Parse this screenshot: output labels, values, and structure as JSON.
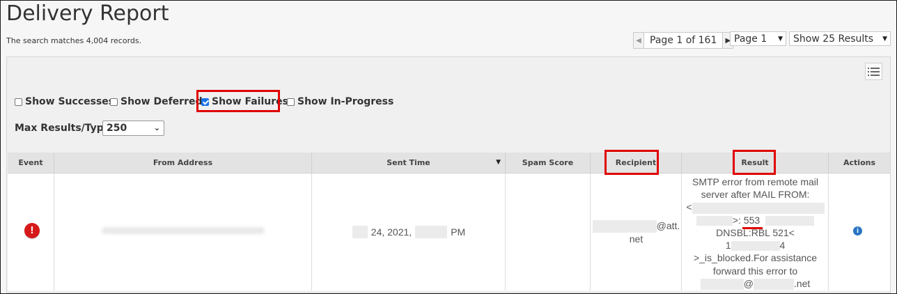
{
  "page": {
    "title": "Delivery Report",
    "matches_text": "The search matches 4,004 records."
  },
  "pager": {
    "label": "Page 1 of 161",
    "page_select": "Page 1",
    "results_select": "Show 25 Results"
  },
  "filters": {
    "show_successes": {
      "label": "Show Successes",
      "checked": false
    },
    "show_deferred": {
      "label": "Show Deferred",
      "checked": false
    },
    "show_failures": {
      "label": "Show Failures",
      "checked": true
    },
    "show_in_progress": {
      "label": "Show In-Progress",
      "checked": false
    },
    "max_results_label": "Max Results/Type:",
    "max_results_value": "250"
  },
  "table": {
    "headers": {
      "event": "Event",
      "from_address": "From Address",
      "sent_time": "Sent Time",
      "spam_score": "Spam Score",
      "recipient": "Recipient",
      "result": "Result",
      "actions": "Actions"
    },
    "rows": [
      {
        "event_icon": "error-icon",
        "sent_time_middle": "24, 2021,",
        "sent_time_suffix": "PM",
        "spam_score": "",
        "recipient_domain": "@att.",
        "recipient_tld": "net",
        "result": {
          "line1": "SMTP error from remote mail",
          "line2": "server after MAIL FROM:",
          "line3_prefix": "<",
          "line4_mid": ">: ",
          "code": "553",
          "line5": "DNSBL:RBL 521<",
          "line6_prefix": "1",
          "line6_suffix": "4",
          "line7": ">_is_blocked.For assistance",
          "line8": "forward this error to",
          "line9_at": "@",
          "line9_suffix": ".net"
        },
        "actions_icon": "info-icon"
      }
    ]
  },
  "colors": {
    "highlight": "#e00000",
    "error": "#d61a1a",
    "info": "#2b74c4",
    "checkbox": "#1a73e8"
  }
}
